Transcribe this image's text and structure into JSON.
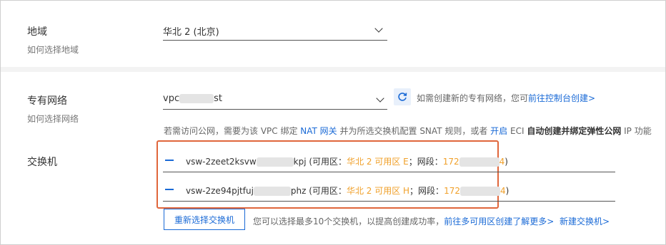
{
  "region": {
    "label": "地域",
    "help": "如何选择地域",
    "value": "华北 2 (北京)"
  },
  "vpc": {
    "label": "专有网络",
    "help": "如何选择网络",
    "value_prefix": "vpc",
    "value_suffix": "st",
    "hint_text": "如需创建新的专有网络，您可",
    "hint_link": "前往控制台创建>",
    "notice": {
      "p1": "若需访问公网，需要为该 VPC 绑定 ",
      "nat_link": "NAT 网关",
      "p2": " 并为所选交换机配置 SNAT 规则，或者 ",
      "enable_link": "开启",
      "p3": " ECI ",
      "bold_text": "自动创建并绑定弹性公网",
      "p4": " IP 功能"
    }
  },
  "switch": {
    "label": "交换机",
    "rows": [
      {
        "id_prefix": "vsw-2zeet2ksvw",
        "id_suffix": "kpj",
        "zone_label": " (可用区：",
        "zone": "华北 2 可用区 E",
        "cidr_label": "；网段：",
        "cidr_prefix": "172",
        "cidr_suffix": "4",
        "close": ")"
      },
      {
        "id_prefix": "vsw-2ze94pjtfuj",
        "id_suffix": "phz",
        "zone_label": " (可用区：",
        "zone": "华北 2 可用区 H",
        "cidr_label": "；网段：",
        "cidr_prefix": "172",
        "cidr_suffix": "4",
        "close": ")"
      }
    ],
    "reselect_button": "重新选择交换机",
    "tip_text": "您可以选择最多10个交换机，以提高创建成功率，",
    "multi_zone_link": "前往多可用区创建了解更多>",
    "new_switch_link": "新建交换机>"
  },
  "colors": {
    "link": "#1a6ad6",
    "zone_text": "#f0a02a",
    "highlight_box": "#e0663b"
  }
}
